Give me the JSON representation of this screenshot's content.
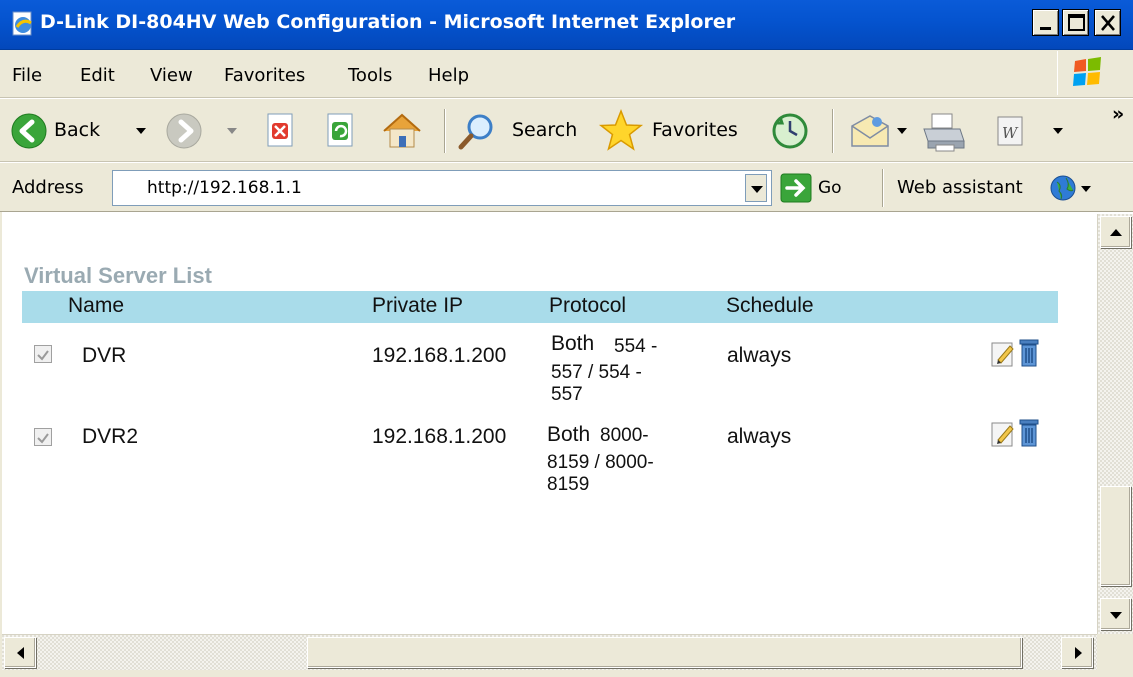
{
  "window": {
    "title": "D-Link DI-804HV Web Configuration - Microsoft Internet Explorer"
  },
  "menu": {
    "items": [
      "File",
      "Edit",
      "View",
      "Favorites",
      "Tools",
      "Help"
    ]
  },
  "toolbar": {
    "back_label": "Back",
    "search_label": "Search",
    "favorites_label": "Favorites",
    "overflow_label": "»"
  },
  "address": {
    "label": "Address",
    "url": "http://192.168.1.1",
    "go_label": "Go",
    "web_assistant_label": "Web assistant"
  },
  "page": {
    "section_title": "Virtual Server List",
    "columns": [
      "Name",
      "Private IP",
      "Protocol",
      "Schedule"
    ],
    "rows": [
      {
        "checked": true,
        "name": "DVR",
        "private_ip": "192.168.1.200",
        "protocol_type": "Both",
        "ports_line1": "554 -",
        "ports_line2": "557 / 554 -",
        "ports_line3": "557",
        "schedule": "always"
      },
      {
        "checked": true,
        "name": "DVR2",
        "private_ip": "192.168.1.200",
        "protocol_type": "Both",
        "ports_line1": "8000-",
        "ports_line2": "8159 / 8000-",
        "ports_line3": "8159",
        "schedule": "always"
      }
    ]
  },
  "icons": {
    "app": "ie-page-icon",
    "back": "back-arrow-icon",
    "forward": "forward-arrow-icon",
    "stop": "stop-icon",
    "refresh": "refresh-icon",
    "home": "home-icon",
    "search": "search-magnifier-icon",
    "favorites": "favorites-star-icon",
    "history": "history-icon",
    "mail": "mail-icon",
    "print": "print-icon",
    "edit": "word-edit-icon",
    "go": "go-arrow-icon",
    "globe": "globe-icon",
    "row_edit": "edit-icon",
    "row_delete": "trash-icon"
  },
  "colors": {
    "titlebar": "#0554d0",
    "header_band": "#a9dcea",
    "section_title": "#9aaab2",
    "chrome": "#ece9d8"
  }
}
